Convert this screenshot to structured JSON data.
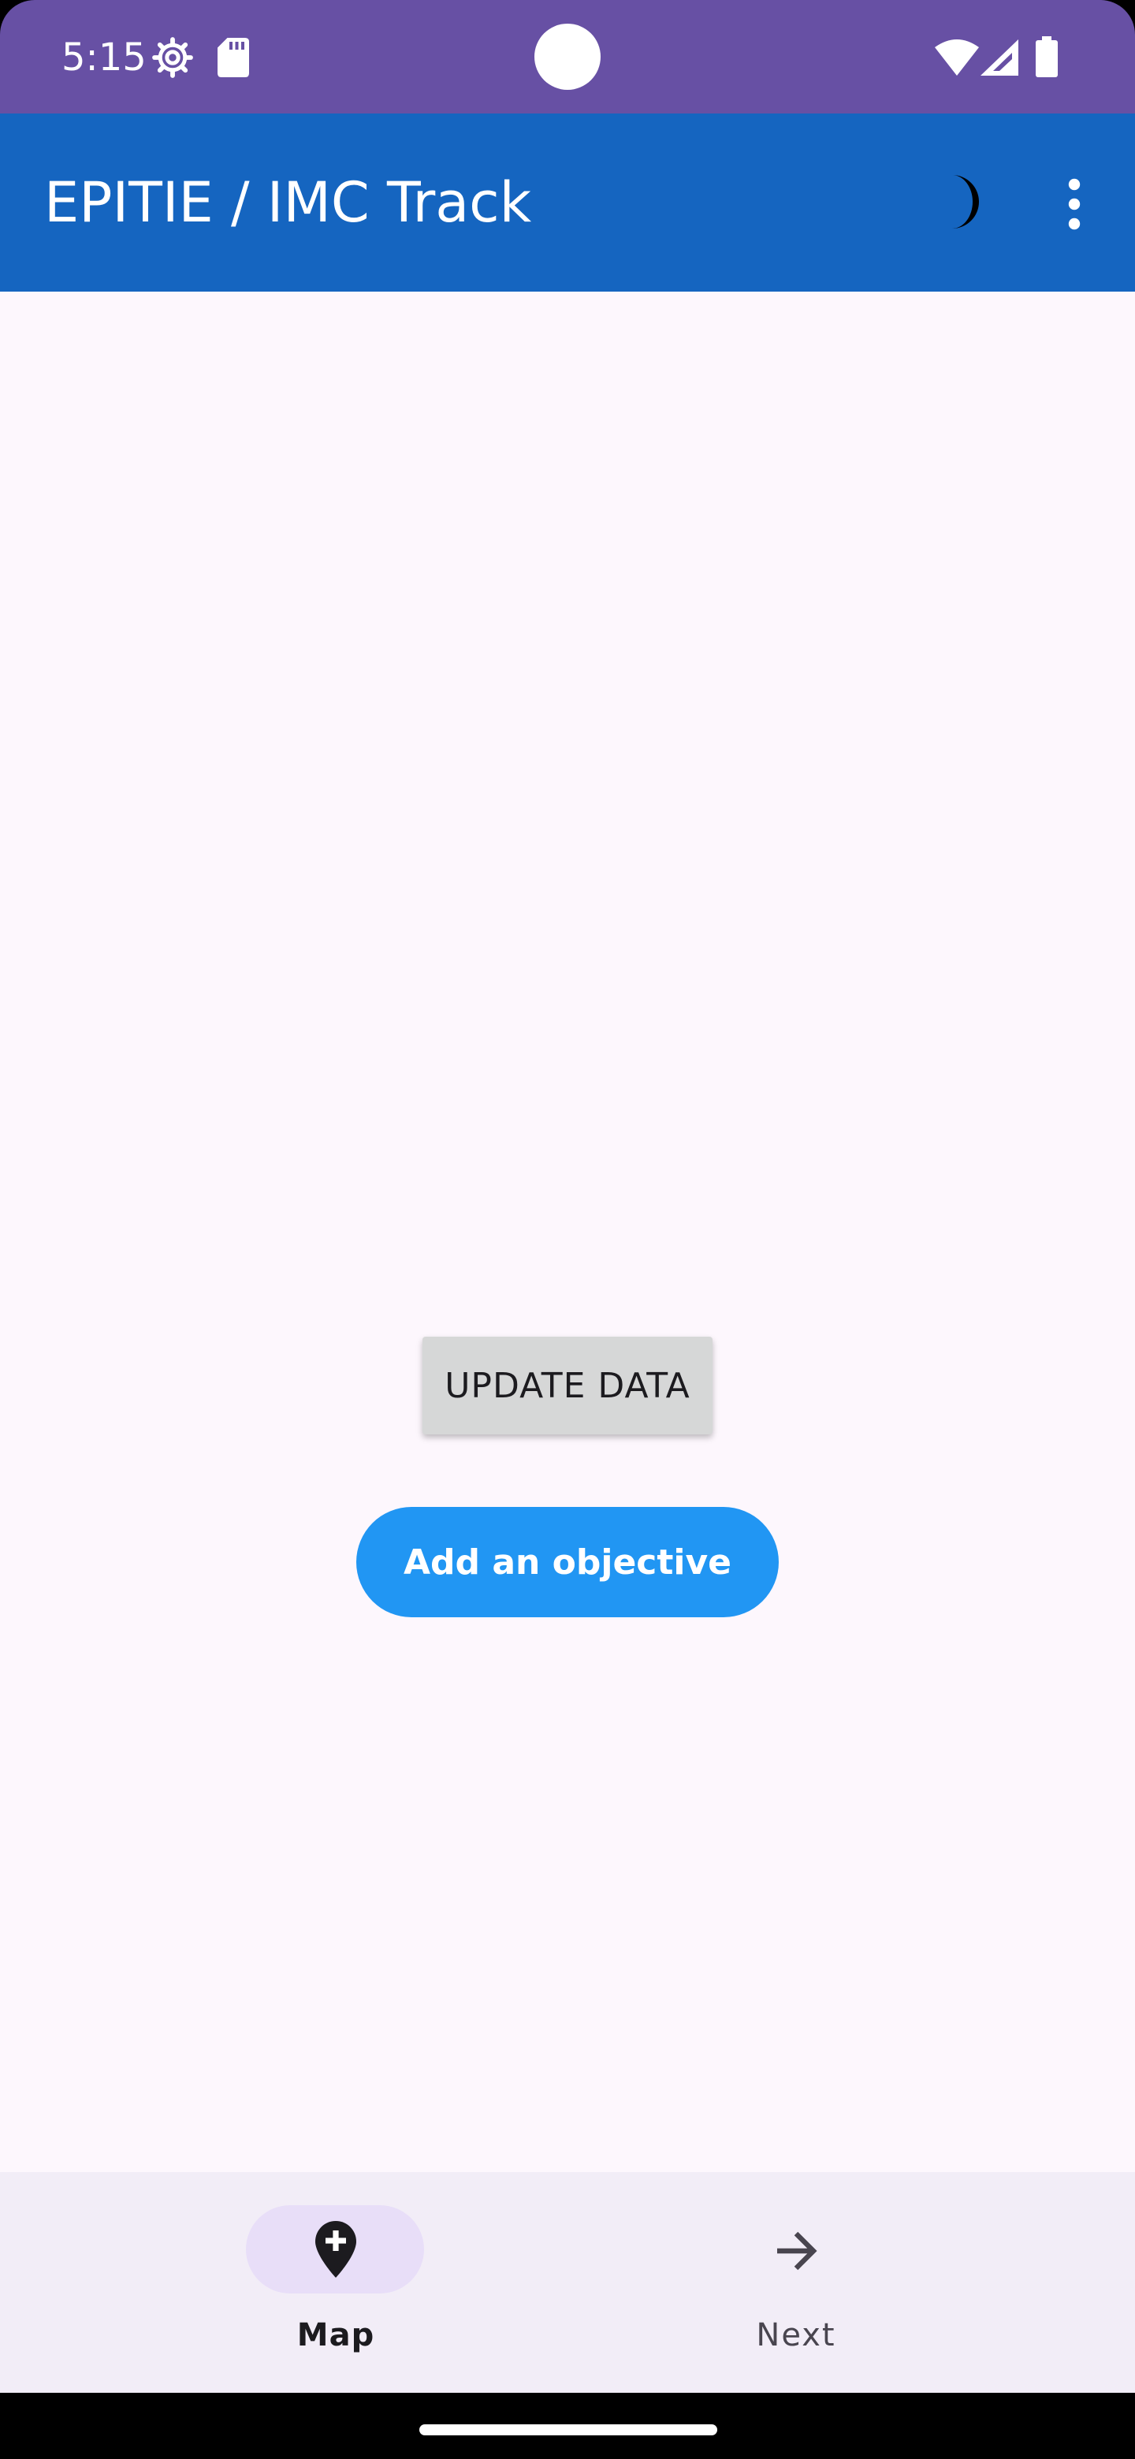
{
  "status_bar": {
    "time": "5:15",
    "icons_left": [
      "settings-gear-icon",
      "sd-card-icon"
    ],
    "icons_right": [
      "wifi-icon",
      "cellular-signal-icon",
      "battery-icon"
    ],
    "color": "#6750A4"
  },
  "app_bar": {
    "title": "EPITIE / IMC Track",
    "actions": [
      "dark-mode-moon-icon",
      "more-vert-icon"
    ],
    "color": "#1565C0"
  },
  "content": {
    "update_button_label": "UPDATE DATA",
    "objective_button_label": "Add an objective",
    "background": "#FDF7FD",
    "objective_button_color": "#2196F3"
  },
  "bottom_nav": {
    "items": [
      {
        "label": "Map",
        "icon": "add-location-icon",
        "selected": true
      },
      {
        "label": "Next",
        "icon": "arrow-forward-icon",
        "selected": false
      }
    ],
    "background": "#F2EDF7",
    "indicator_color": "#E8DEF8"
  }
}
